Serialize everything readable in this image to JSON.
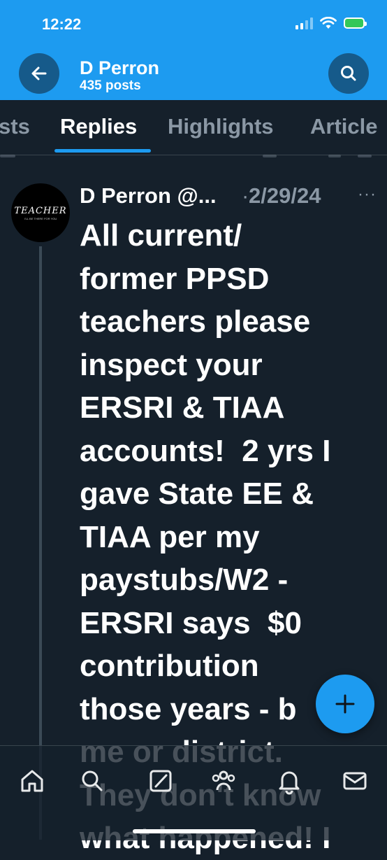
{
  "status_bar": {
    "time": "12:22"
  },
  "header": {
    "name": "D Perron",
    "posts_count": "435 posts",
    "back_icon": "arrow-left-icon",
    "search_icon": "search-icon"
  },
  "tabs": [
    {
      "label": "sts",
      "active": false
    },
    {
      "label": "Replies",
      "active": true
    },
    {
      "label": "Highlights",
      "active": false
    },
    {
      "label": "Article",
      "active": false
    }
  ],
  "tweet": {
    "avatar_text": "TEACHER",
    "avatar_subtext": "I'LL BE THERE FOR YOU",
    "author": "D Perron @...",
    "separator": "·",
    "date": "2/29/24",
    "more_label": "···",
    "text": "All current/\nformer PPSD\nteachers please\ninspect your\nERSRI & TIAA\naccounts!  2 yrs I\ngave State EE &\nTIAA per my\npaystubs/W2 -\nERSRI says  $0\ncontribution\nthose years - b\nme or district.\nThey don't know\nwhat happened! I"
  },
  "fab": {
    "label": "+",
    "icon": "compose-plus-icon"
  },
  "bottom_nav": [
    {
      "icon": "home-icon"
    },
    {
      "icon": "search-icon"
    },
    {
      "icon": "grok-icon"
    },
    {
      "icon": "communities-icon"
    },
    {
      "icon": "notifications-icon"
    },
    {
      "icon": "messages-icon"
    }
  ],
  "colors": {
    "accent": "#1d9bf0",
    "background": "#15202b",
    "muted": "#8b98a5"
  }
}
